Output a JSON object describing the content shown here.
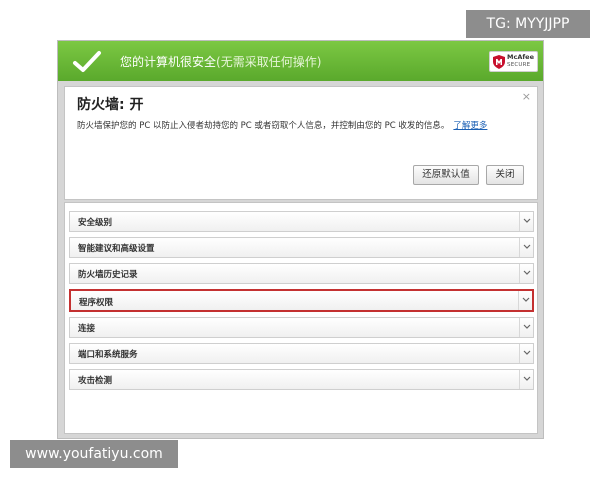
{
  "header": {
    "title": "您的计算机很安全",
    "hint": "(无需采取任何操作)",
    "brand": "McAfee",
    "brand_sub": "SECURE"
  },
  "panel": {
    "title": "防火墙: 开",
    "description": "防火墙保护您的 PC 以防止入侵者劫持您的 PC 或者窃取个人信息，并控制由您的 PC 收发的信息。",
    "learn_more": "了解更多",
    "close_symbol": "×",
    "restore_button": "还原默认值",
    "close_button": "关闭"
  },
  "sections": [
    {
      "label": "安全级别",
      "selected": false
    },
    {
      "label": "智能建议和高级设置",
      "selected": false
    },
    {
      "label": "防火墙历史记录",
      "selected": false
    },
    {
      "label": "程序权限",
      "selected": true
    },
    {
      "label": "连接",
      "selected": false
    },
    {
      "label": "端口和系统服务",
      "selected": false
    },
    {
      "label": "攻击检测",
      "selected": false
    }
  ],
  "watermarks": {
    "telegram": "TG: MYYJJPP",
    "site": "www.youfatiyu.com"
  },
  "colors": {
    "header_green": "#5aa92c",
    "link_blue": "#1a5fb4",
    "selected_border": "#c43131"
  }
}
